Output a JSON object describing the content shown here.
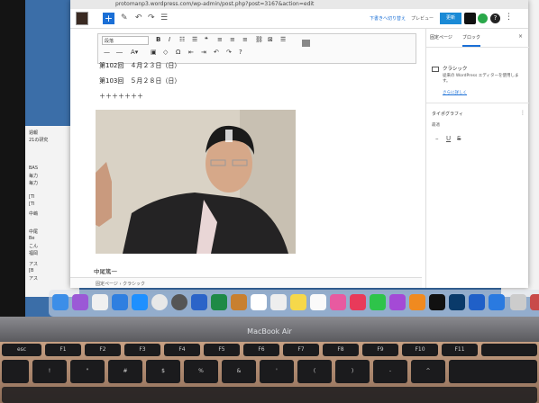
{
  "browser": {
    "url": "protomanp3.wordpress.com/wp-admin/post.php?post=3167&action=edit"
  },
  "toolbar": {
    "save_draft": "下書きへ切り替え",
    "preview": "プレビュー",
    "publish": "更新",
    "gear_color": "#2aa84a"
  },
  "classic_toolbar": {
    "format": "段落"
  },
  "content": {
    "line1": "第102回　４月２３日（日）",
    "line2": "第103回　５月２８日（日）",
    "line3": "＋＋＋＋＋＋＋",
    "caption": "中尾篤一"
  },
  "footer": {
    "breadcrumb_1": "固定ページ",
    "breadcrumb_sep": "›",
    "breadcrumb_2": "クラシック"
  },
  "panel": {
    "tab_page": "固定ページ",
    "tab_block": "ブロック",
    "close": "×",
    "block_title": "クラシック",
    "block_desc": "従来の WordPress エディターを使用します。",
    "block_link": "さらに詳しく",
    "section": "タイポグラフィ",
    "size_label": "最適",
    "dots": "⋮"
  },
  "background_window": {
    "rows": [
      "週報",
      "21の研究",
      "BAS",
      "毎力",
      "毎力",
      "[TI",
      "[TI",
      "中嶋",
      "中尾",
      "Be",
      "こん",
      "福岡",
      "アス",
      "[B",
      "アス"
    ]
  },
  "laptop": {
    "brand": "MacBook Air"
  },
  "keyboard": {
    "keys": [
      "esc",
      "F1",
      "F2",
      "F3",
      "F4",
      "F5",
      "F6",
      "F7",
      "F8",
      "F9",
      "F10",
      "F11"
    ],
    "row2": [
      "!",
      "\"",
      "#",
      "$",
      "%",
      "&",
      "'",
      "(",
      ")",
      "-",
      "^"
    ]
  }
}
